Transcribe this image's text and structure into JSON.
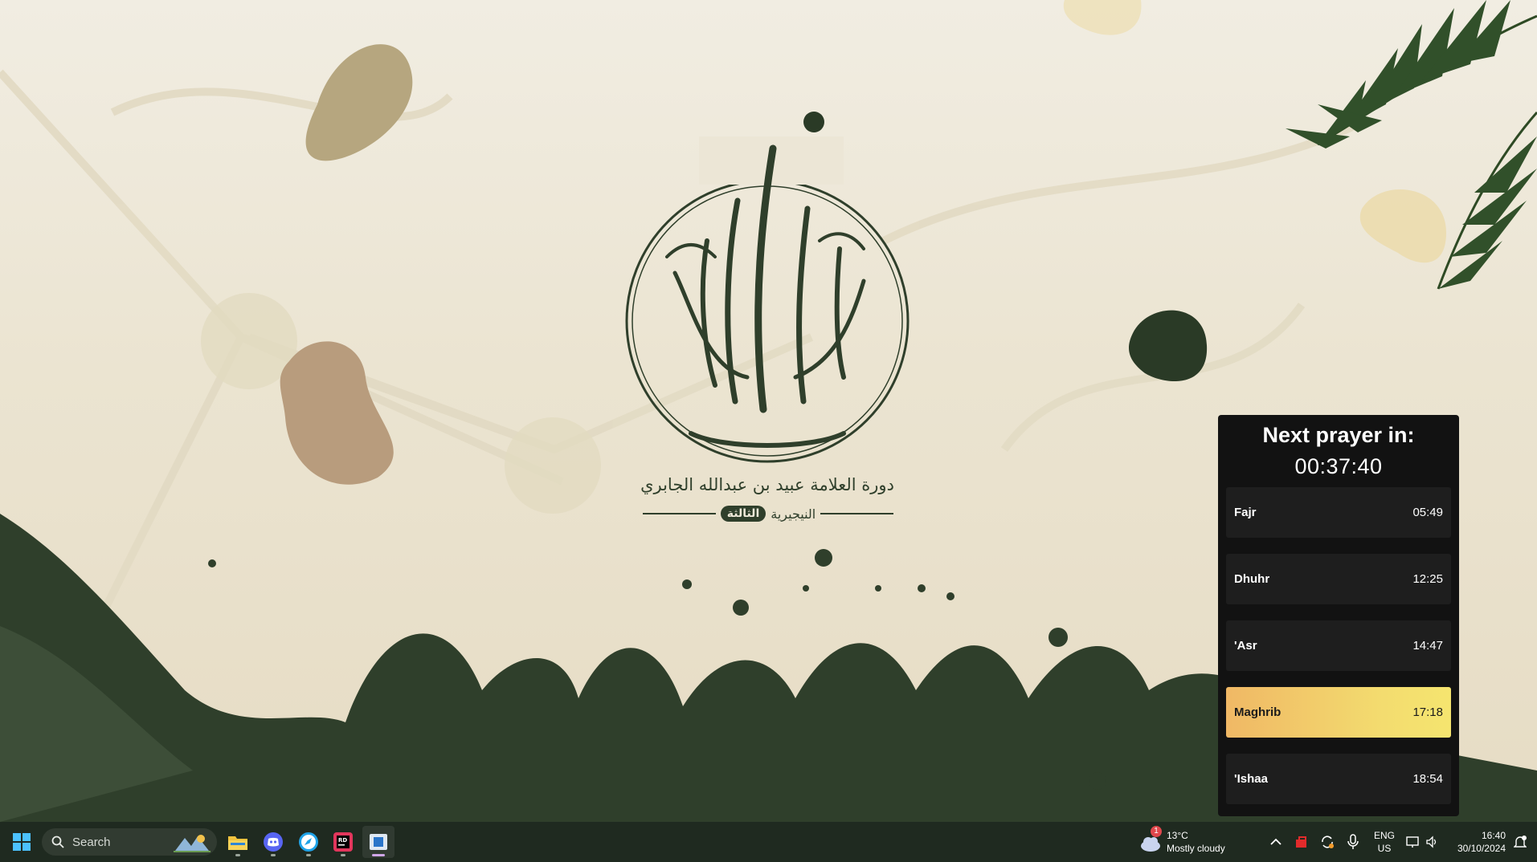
{
  "wallpaper": {
    "emblem_title": "دورة العلامة عبيد بن عبدالله الجابري",
    "emblem_subtitle_word": "النيجيرية",
    "emblem_subtitle_pill": "الثالثة",
    "colors": {
      "dark_green": "#2f3f2b",
      "background": "#ebe4d1",
      "blob_tan": "#b6a67f",
      "blob_brown": "#b89c7d"
    }
  },
  "prayer_widget": {
    "heading": "Next prayer in:",
    "countdown": "00:37:40",
    "prayers": [
      {
        "name": "Fajr",
        "time": "05:49",
        "active": false
      },
      {
        "name": "Dhuhr",
        "time": "12:25",
        "active": false
      },
      {
        "name": "'Asr",
        "time": "14:47",
        "active": false
      },
      {
        "name": "Maghrib",
        "time": "17:18",
        "active": true
      },
      {
        "name": "'Ishaa",
        "time": "18:54",
        "active": false
      }
    ],
    "colors": {
      "background": "#121212",
      "row": "#1e1e1e",
      "active_start": "#f0b865",
      "active_end": "#f5e56f"
    }
  },
  "taskbar": {
    "search_label": "Search",
    "apps": [
      {
        "name": "File Explorer",
        "icon": "folder-icon"
      },
      {
        "name": "Discord",
        "icon": "discord-icon"
      },
      {
        "name": "Browser",
        "icon": "compass-icon"
      },
      {
        "name": "Rider",
        "icon": "rider-icon"
      },
      {
        "name": "Widget App",
        "icon": "window-icon"
      }
    ],
    "weather": {
      "temperature": "13°C",
      "condition": "Mostly cloudy",
      "badge": "1"
    },
    "language": {
      "line1": "ENG",
      "line2": "US"
    },
    "clock": {
      "time": "16:40",
      "date": "30/10/2024"
    }
  }
}
